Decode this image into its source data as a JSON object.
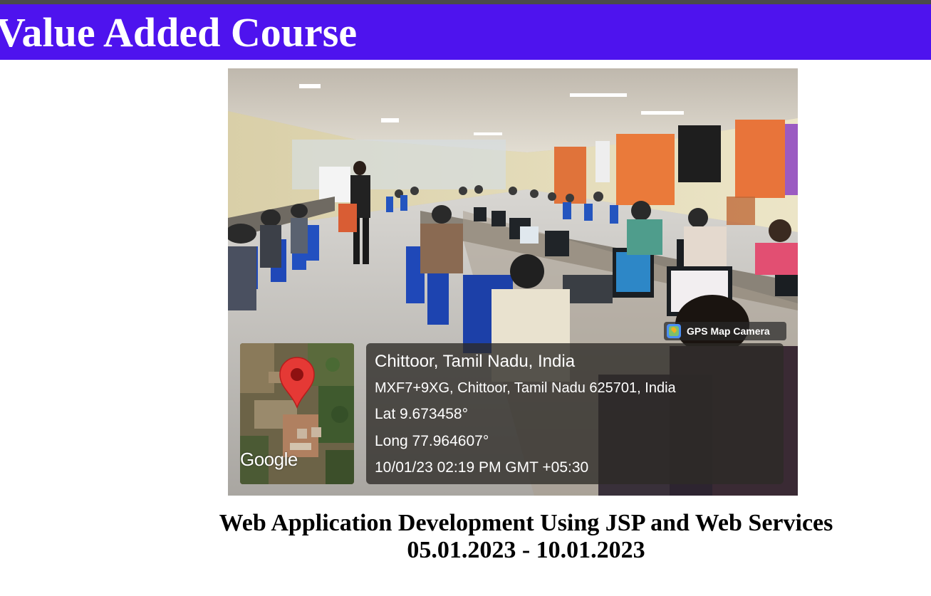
{
  "banner": {
    "title": "Value Added Course",
    "background": "#4e13ee",
    "text_color": "#ffffff"
  },
  "photo": {
    "gps_badge": {
      "icon": "gps-map-camera-icon",
      "label": "GPS Map Camera"
    },
    "map": {
      "icon": "map-pin-icon",
      "brand": "Google"
    },
    "location": {
      "place": "Chittoor, Tamil Nadu, India",
      "address": "MXF7+9XG, Chittoor, Tamil Nadu 625701, India",
      "lat": "Lat 9.673458°",
      "long": "Long 77.964607°",
      "timestamp": "10/01/23 02:19 PM GMT +05:30"
    }
  },
  "caption": {
    "course": "Web Application Development Using JSP and Web Services",
    "dates": "05.01.2023 - 10.01.2023"
  }
}
